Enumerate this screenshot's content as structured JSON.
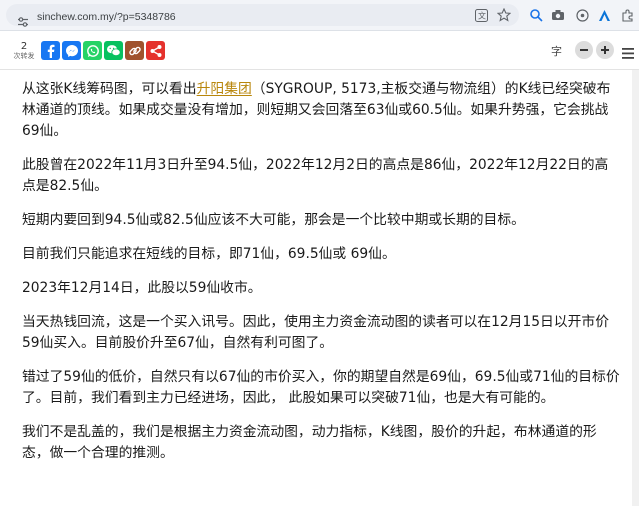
{
  "browser": {
    "url": "sinchew.com.my/?p=5348786",
    "icons": [
      "translate-icon",
      "bookmark-star-icon",
      "lens-icon",
      "camera-icon",
      "extension-icon",
      "azure-a-icon",
      "puzzle-icon"
    ]
  },
  "toolbar": {
    "share_count": "2",
    "share_label": "次转发",
    "font_label": "字",
    "share_buttons": [
      "facebook",
      "messenger",
      "whatsapp",
      "wechat",
      "copy-link",
      "share"
    ],
    "colors": {
      "facebook": "#1877f2",
      "messenger": "#1877f2",
      "whatsapp": "#25d366",
      "wechat": "#07c160",
      "copy": "#a0522d",
      "share": "#e5322d"
    }
  },
  "article": {
    "p1_before": "从这张K线筹码图，可以看出",
    "p1_link": "升阳集团",
    "p1_after": "（SYGROUP, 5173,主板交通与物流组）的K线已经突破布林通道的顶线。如果成交量没有增加，则短期又会回落至63仙或60.5仙。如果升势强，它会挑战69仙。",
    "p2": "此股曾在2022年11月3日升至94.5仙，2022年12月2日的高点是86仙，2022年12月22日的高点是82.5仙。",
    "p3": "短期内要回到94.5仙或82.5仙应该不大可能，那会是一个比较中期或长期的目标。",
    "p4": "目前我们只能追求在短线的目标，即71仙，69.5仙或 69仙。",
    "p5": "2023年12月14日，此股以59仙收市。",
    "p6": "当天热钱回流，这是一个买入讯号。因此，使用主力资金流动图的读者可以在12月15日以开市价59仙买入。目前股价升至67仙，自然有利可图了。",
    "p7": "错过了59仙的低价，自然只有以67仙的市价买入，你的期望自然是69仙，69.5仙或71仙的目标价了。目前，我们看到主力已经进场，因此， 此股如果可以突破71仙，也是大有可能的。",
    "p8": "我们不是乱盖的，我们是根据主力资金流动图，动力指标，K线图，股价的升起，布林通道的形态，做一个合理的推测。"
  }
}
